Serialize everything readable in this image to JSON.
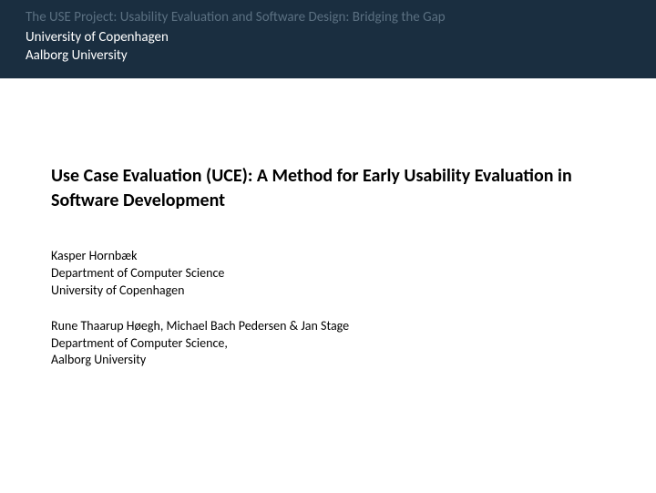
{
  "header": {
    "project": "The USE Project: Usability Evaluation and Software Design: Bridging the Gap",
    "univ1": "University of Copenhagen",
    "univ2": "Aalborg University"
  },
  "title": "Use Case Evaluation (UCE): A Method for Early Usability Evaluation in Software Development",
  "authors": [
    {
      "name": "Kasper Hornbæk",
      "dept": "Department of Computer Science",
      "univ": "University of Copenhagen"
    },
    {
      "name": "Rune Thaarup Høegh, Michael Bach Pedersen & Jan Stage",
      "dept": "Department of Computer Science,",
      "univ": "Aalborg University"
    }
  ]
}
